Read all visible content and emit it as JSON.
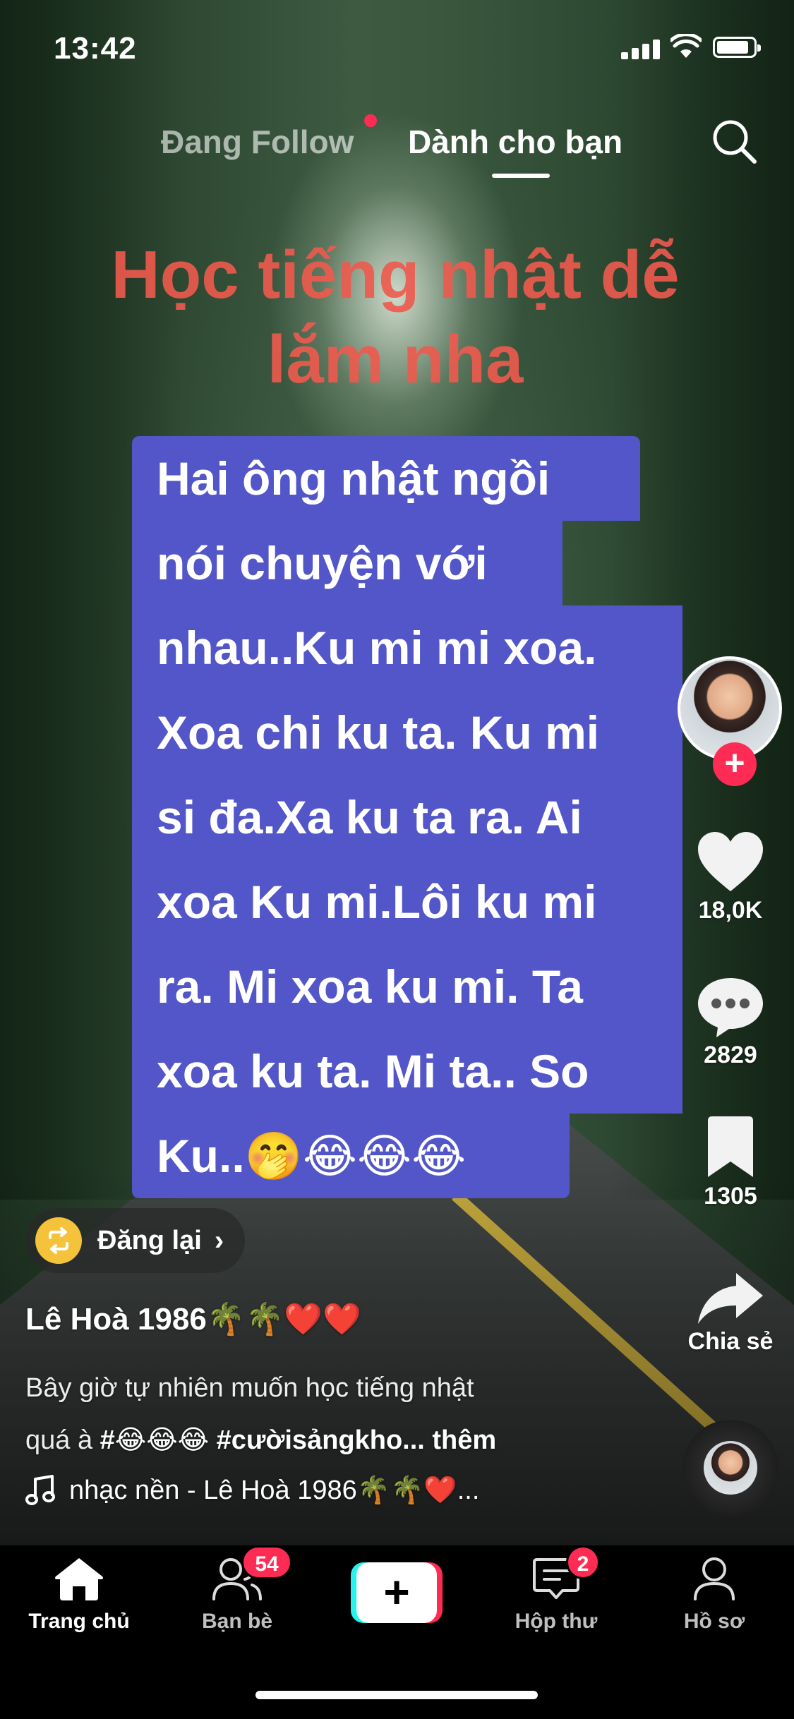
{
  "status_bar": {
    "time": "13:42"
  },
  "top_tabs": {
    "following": "Đang Follow",
    "for_you": "Dành cho bạn",
    "active": "for_you",
    "following_has_dot": true,
    "search_icon": "search-icon"
  },
  "video": {
    "overlay_title_lines": [
      "Học tiếng nhật dễ",
      "lắm nha"
    ],
    "caption_lines": [
      "Hai ông nhật ngồi",
      "nói chuyện với",
      "nhau..Ku mi mi xoa.",
      "Xoa chi ku ta. Ku mi",
      "si đa.Xa ku ta ra. Ai",
      "xoa Ku mi.Lôi ku mi",
      "ra. Mi xoa ku mi. Ta",
      "xoa  ku ta. Mi ta.. So",
      "Ku..🤭😂😂😂"
    ]
  },
  "actions": {
    "follow_plus": "+",
    "likes": "18,0K",
    "comments": "2829",
    "saves": "1305",
    "share_label": "Chia sẻ"
  },
  "repost": {
    "label": "Đăng lại",
    "chevron": "›"
  },
  "post": {
    "author": "Lê Hoà 1986🌴🌴❤️❤️",
    "description_line1": "Bây giờ tự nhiên muốn học tiếng nhật",
    "description_line2_prefix": "quá à ",
    "description_hashtag1": "#😂😂😂",
    "description_hashtag2": "#cườisảngkho...",
    "description_more": "thêm",
    "music": "nhạc nền - Lê Hoà 1986🌴🌴❤️..."
  },
  "bottom_nav": {
    "home": "Trang chủ",
    "friends": "Bạn bè",
    "friends_badge": "54",
    "create": "+",
    "inbox": "Hộp thư",
    "inbox_badge": "2",
    "profile": "Hồ sơ"
  },
  "colors": {
    "accent": "#fe2c55",
    "caption_bg": "#5256c8",
    "overlay_title": "#ef5a4e",
    "repost_icon": "#f5c33b"
  }
}
